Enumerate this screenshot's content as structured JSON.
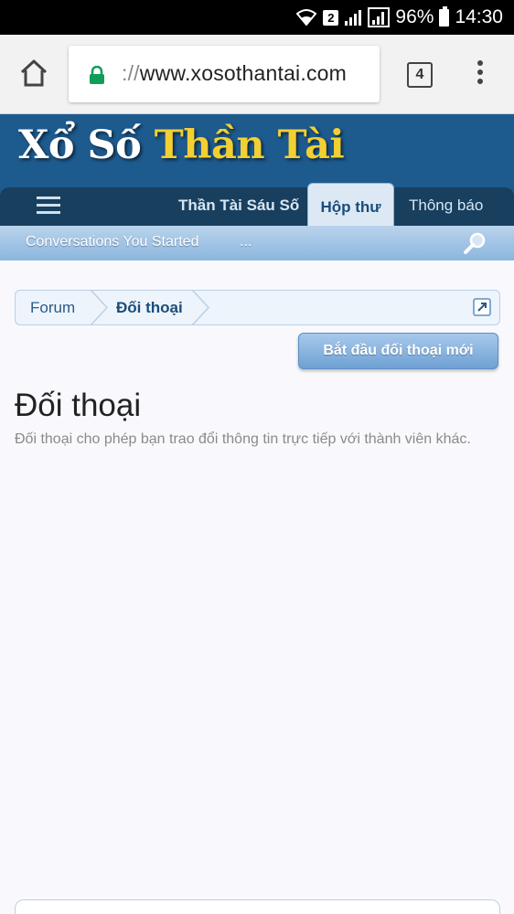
{
  "status_bar": {
    "sim_slot": "2",
    "battery_percent": "96%",
    "time": "14:30"
  },
  "browser": {
    "url_prefix": "://",
    "url_domain": "www.xosothantai.com",
    "tab_count": "4"
  },
  "site": {
    "logo_part1": "Xổ Số",
    "logo_part2": "Thần Tài",
    "nav": {
      "tab_six_numbers": "Thần Tài Sáu Số",
      "tab_inbox": "Hộp thư",
      "tab_notifications": "Thông báo"
    },
    "subnav": {
      "conversations_started": "Conversations You Started",
      "more": "..."
    }
  },
  "breadcrumb": {
    "forum": "Forum",
    "current": "Đối thoại"
  },
  "start_button": "Bắt đầu đối thoại mới",
  "page": {
    "title": "Đối thoại",
    "description": "Đối thoại cho phép bạn trao đổi thông tin trực tiếp với thành viên khác."
  },
  "colors": {
    "header_bg": "#1d5a8e",
    "nav_bg": "#183f5e",
    "logo_accent": "#f2d033",
    "lock_green": "#0f9d58"
  },
  "icons": {
    "home": "home-icon",
    "lock": "lock-icon",
    "tabs": "tabs-icon",
    "menu": "overflow-menu-icon",
    "hamburger": "hamburger-icon",
    "search": "search-icon",
    "jump": "jump-link-icon"
  }
}
